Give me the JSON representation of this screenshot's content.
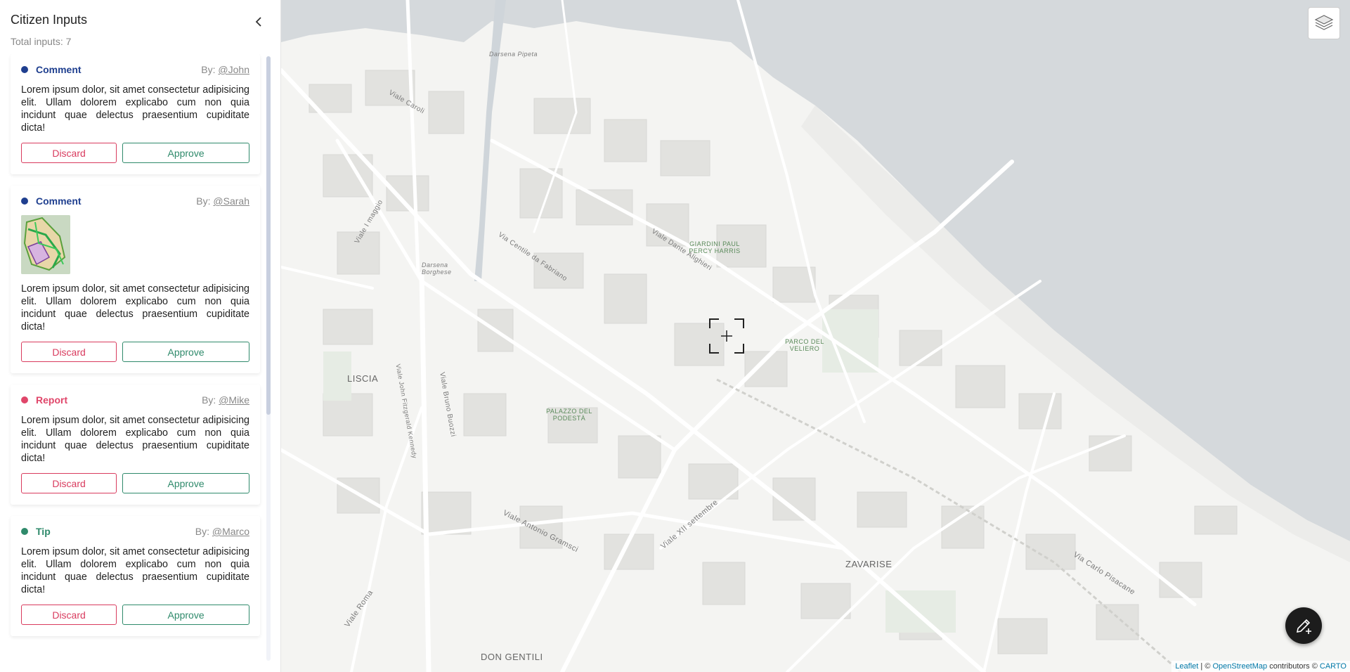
{
  "sidebar": {
    "title": "Citizen Inputs",
    "total": "Total inputs: 7",
    "cards": [
      {
        "type": "Comment",
        "color": "#1f3f8f",
        "by": "By:",
        "user": "@John",
        "text": "Lorem ipsum dolor, sit amet consectetur adipisicing elit. Ullam dolorem explicabo cum non quia incidunt quae delectus praesentium cupiditate dicta!",
        "discard": "Discard",
        "approve": "Approve"
      },
      {
        "type": "Comment",
        "color": "#1f3f8f",
        "by": "By:",
        "user": "@Sarah",
        "text": "Lorem ipsum dolor, sit amet consectetur adipisicing elit. Ullam dolorem explicabo cum non quia incidunt quae delectus praesentium cupiditate dicta!",
        "discard": "Discard",
        "approve": "Approve"
      },
      {
        "type": "Report",
        "color": "#e0466a",
        "by": "By:",
        "user": "@Mike",
        "text": "Lorem ipsum dolor, sit amet consectetur adipisicing elit. Ullam dolorem explicabo cum non quia incidunt quae delectus praesentium cupiditate dicta!",
        "discard": "Discard",
        "approve": "Approve"
      },
      {
        "type": "Tip",
        "color": "#2f8a6b",
        "by": "By:",
        "user": "@Marco",
        "text": "Lorem ipsum dolor, sit amet consectetur adipisicing elit. Ullam dolorem explicabo cum non quia incidunt quae delectus praesentium cupiditate dicta!",
        "discard": "Discard",
        "approve": "Approve"
      }
    ]
  },
  "map": {
    "labels": {
      "liscia": "LISCIA",
      "zavarise": "ZAVARISE",
      "don_gentili": "DON GENTILI",
      "palazzo": "PALAZZO DEL PODESTÀ",
      "giardini": "GIARDINI PAUL PERCY HARRIS",
      "parco": "PARCO DEL VELIERO",
      "darsena_pipeta": "Darsena Pipeta",
      "darsena_borghese": "Darsena Borghese",
      "viale_roma": "Viale Roma",
      "viale_gramsci": "Viale Antonio Gramsci",
      "viale_xii": "Viale XII settembre",
      "via_pisacane": "Via Carlo Pisacane",
      "via_centile": "Via Centile da Fabriano",
      "viale_dante": "Viale Dante Alighieri",
      "viale_imaggio": "Viale I maggio",
      "viale_kennedy": "Viale John Fitzgerald Kennedy",
      "viale_buozzi": "Viale Bruno Buozzi",
      "viale_caroli": "Viale Caroli"
    },
    "attribution": {
      "leaflet": "Leaflet",
      "sep": " | © ",
      "osm": "OpenStreetMap",
      "contrib": " contributors © ",
      "carto": "CARTO"
    }
  }
}
